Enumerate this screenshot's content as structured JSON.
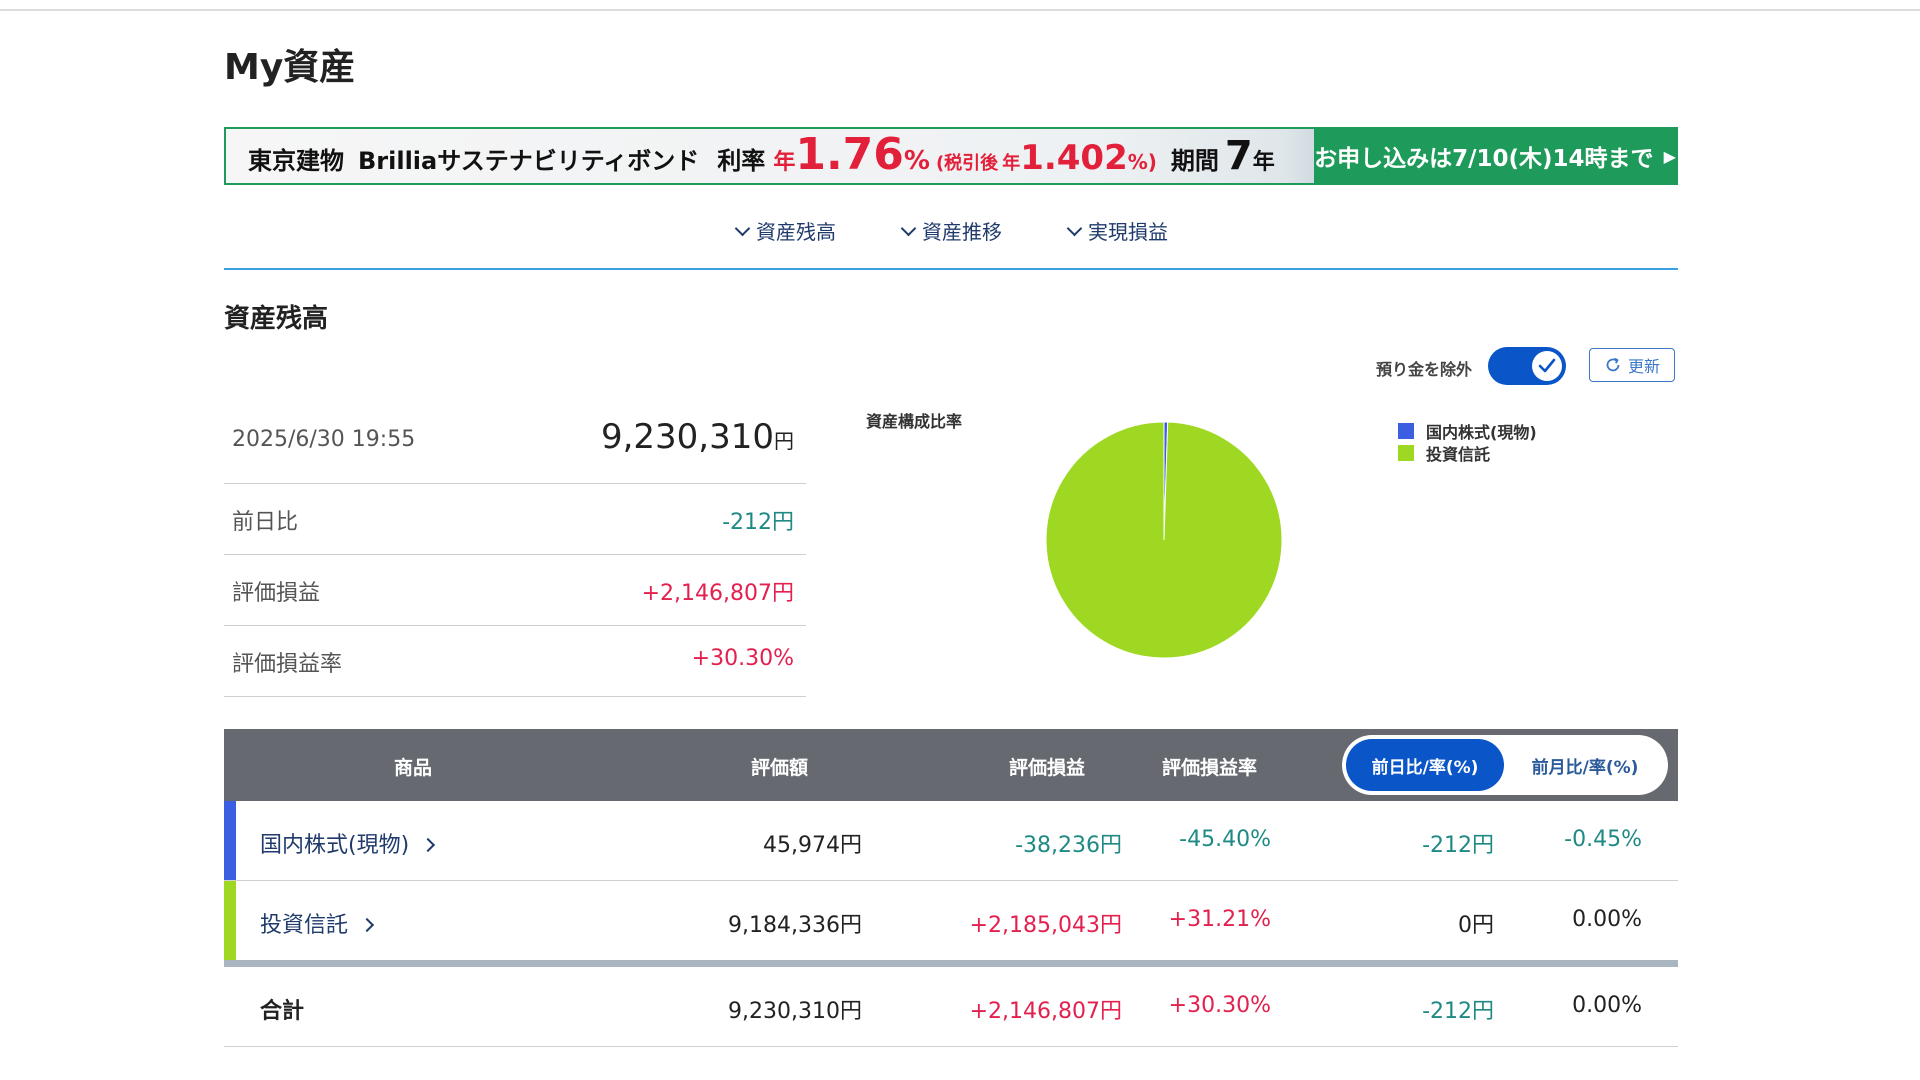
{
  "page": {
    "title": "My資産"
  },
  "banner": {
    "company": "東京建物",
    "product": "Brilliaサステナビリティボンド",
    "rate_label": "利率",
    "rate_prefix": "年",
    "rate": "1.76",
    "rate_pct": "%",
    "after_tax_label": "(税引後",
    "after_tax_prefix": "年",
    "after_tax_rate": "1.402",
    "after_tax_pct": "%)",
    "term_label": "期間",
    "term": "7",
    "term_unit": "年",
    "cta": "お申し込みは7/10(木)14時まで",
    "cta_arrow": "▶",
    "accent_color": "#1e9a5a",
    "rate_color": "#e3203a"
  },
  "anchors": [
    {
      "label": "資産残高"
    },
    {
      "label": "資産推移"
    },
    {
      "label": "実現損益"
    }
  ],
  "section": {
    "title": "資産残高"
  },
  "controls": {
    "exclude_deposit_label": "預り金を除外",
    "exclude_deposit_on": true,
    "refresh_label": "更新"
  },
  "summary": {
    "datetime": "2025/6/30 19:55",
    "total_value": "9,230,310",
    "total_unit": "円",
    "rows": [
      {
        "label": "前日比",
        "value": "-212円"
      },
      {
        "label": "評価損益",
        "value": "+2,146,807円"
      },
      {
        "label": "評価損益率",
        "value": "+30.30%"
      }
    ]
  },
  "chart_data": {
    "type": "pie",
    "title": "資産構成比率",
    "legend_position": "right",
    "categories": [
      "国内株式(現物)",
      "投資信託"
    ],
    "values": [
      45974,
      9184336
    ],
    "colors": [
      "#3b5fe0",
      "#9ed822"
    ]
  },
  "table": {
    "headers": {
      "product": "商品",
      "value": "評価額",
      "pl": "評価損益",
      "pl_rate": "評価損益率"
    },
    "tabs": {
      "active": "前日比/率(%)",
      "inactive": "前月比/率(%)"
    },
    "rows": [
      {
        "name": "国内株式(現物)",
        "value": "45,974円",
        "pl": "-38,236円",
        "pl_rate": "-45.40%",
        "day_change": "-212円",
        "day_rate": "-0.45%",
        "color": "#3b5fe0"
      },
      {
        "name": "投資信託",
        "value": "9,184,336円",
        "pl": "+2,185,043円",
        "pl_rate": "+31.21%",
        "day_change": "0円",
        "day_rate": "0.00%",
        "color": "#9ed822"
      }
    ],
    "total": {
      "label": "合計",
      "value": "9,230,310円",
      "pl": "+2,146,807円",
      "pl_rate": "+30.30%",
      "day_change": "-212円",
      "day_rate": "0.00%"
    }
  }
}
